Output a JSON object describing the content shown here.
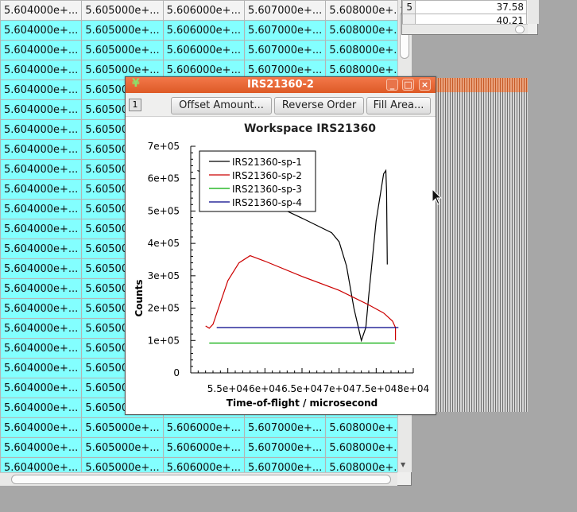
{
  "table": {
    "cell_values": [
      "5.604000e+...",
      "5.605000e+...",
      "5.606000e+...",
      "5.607000e+...",
      "5.608000e+..."
    ],
    "partial_cell": "5.604000e+",
    "colors": {
      "selected_row": "#83ffff",
      "plain_row": "#f3f3f3"
    }
  },
  "mini_table": {
    "rows": [
      {
        "key": "5",
        "value": "37.58"
      },
      {
        "key": "",
        "value": "40.21"
      }
    ]
  },
  "plot_window": {
    "title": "IRS21360-2",
    "app_icon": "mantid-icon",
    "controls": {
      "minimize": "_",
      "maximize": "□",
      "close": "×"
    },
    "layer_number": "1",
    "toolbar": {
      "offset": "Offset Amount...",
      "reverse": "Reverse Order",
      "fill": "Fill Area..."
    }
  },
  "chart_data": {
    "type": "line",
    "title": "Workspace IRS21360",
    "xlabel": "Time-of-flight / microsecond",
    "ylabel": "Counts",
    "xlim": [
      50000,
      80000
    ],
    "ylim": [
      0,
      700000
    ],
    "xticks": [
      50000,
      55000,
      60000,
      65000,
      70000,
      75000,
      80000
    ],
    "xtick_labels": [
      "",
      "5.5e+04",
      "6e+04",
      "6.5e+04",
      "7e+04",
      "7.5e+04",
      "8e+04"
    ],
    "yticks": [
      0,
      100000,
      200000,
      300000,
      400000,
      500000,
      600000,
      700000
    ],
    "ytick_labels": [
      "0",
      "1e+05",
      "2e+05",
      "3e+05",
      "4e+05",
      "5e+05",
      "6e+05",
      "7e+05"
    ],
    "legend_position": "top-left",
    "series": [
      {
        "name": "IRS21360-sp-1",
        "color": "#000000",
        "x": [
          50900,
          55000,
          60000,
          65000,
          69000,
          70000,
          71000,
          72000,
          73000,
          73600,
          74000,
          75000,
          76000,
          76300,
          76400,
          76500
        ],
        "y": [
          625000,
          590000,
          532000,
          478000,
          433000,
          405000,
          330000,
          200000,
          100000,
          140000,
          240000,
          470000,
          615000,
          625000,
          560000,
          335000
        ]
      },
      {
        "name": "IRS21360-sp-2",
        "color": "#cc0000",
        "x": [
          52000,
          52500,
          53000,
          55000,
          56500,
          58000,
          60000,
          65000,
          70000,
          74000,
          76000,
          77200,
          77600,
          77600
        ],
        "y": [
          145000,
          138000,
          150000,
          285000,
          340000,
          362000,
          345000,
          298000,
          255000,
          210000,
          185000,
          160000,
          140000,
          100000
        ]
      },
      {
        "name": "IRS21360-sp-3",
        "color": "#00aa00",
        "x": [
          52500,
          77500
        ],
        "y": [
          92000,
          92000
        ]
      },
      {
        "name": "IRS21360-sp-4",
        "color": "#000088",
        "x": [
          53500,
          78000
        ],
        "y": [
          140000,
          140000
        ]
      }
    ]
  }
}
